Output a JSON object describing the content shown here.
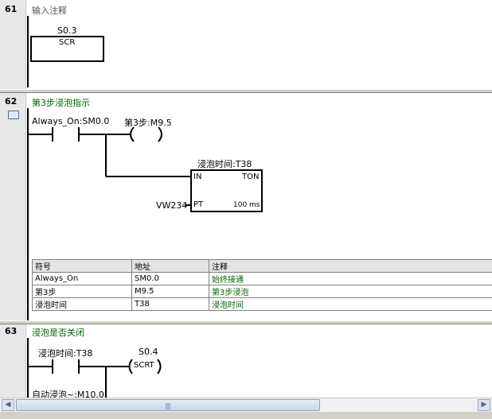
{
  "networks": [
    {
      "number": "61",
      "comment": "输入注释",
      "instruction": {
        "operand": "S0.3",
        "label": "SCR"
      }
    },
    {
      "number": "62",
      "comment": "第3步浸泡指示",
      "contact1": "Always_On:SM0.0",
      "coil": {
        "operand": "第3步:M9.5",
        "label": "(     )"
      },
      "timer": {
        "name": "浸泡时间:T38",
        "in_label": "IN",
        "type": "TON",
        "pt_label": "PT",
        "pt_operand": "VW234",
        "resolution": "100 ms"
      },
      "symbol_table": {
        "headers": [
          "符号",
          "地址",
          "注释"
        ],
        "rows": [
          [
            "Always_On",
            "SM0.0",
            "始终接通"
          ],
          [
            "第3步",
            "M9.5",
            "第3步浸泡"
          ],
          [
            "浸泡时间",
            "T38",
            "浸泡时间"
          ]
        ]
      }
    },
    {
      "number": "63",
      "comment": "浸泡是否关闭",
      "contact1": "浸泡时间:T38",
      "coil": {
        "operand": "S0.4",
        "label": "SCRT"
      },
      "contact2": "自动浸泡~:M10.0"
    }
  ],
  "scrollbar": {
    "left_arrow": "◀",
    "right_arrow": "▶",
    "grip": "||||"
  },
  "colors": {
    "comment_green": "#006600",
    "rail": "#000000",
    "gutter": "#e8e8e8"
  }
}
